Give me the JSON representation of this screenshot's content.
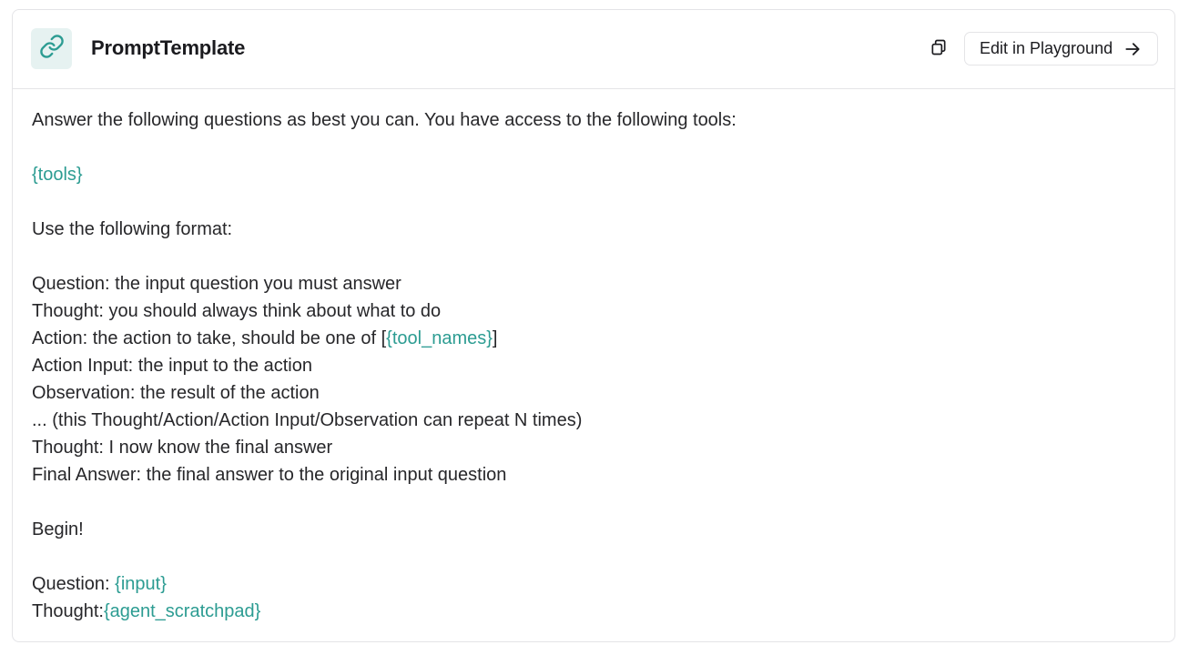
{
  "header": {
    "title": "PromptTemplate",
    "logo_icon": "link-icon",
    "copy_icon": "copy-icon",
    "edit_label": "Edit in Playground",
    "edit_icon": "arrow-right-icon"
  },
  "colors": {
    "accent": "#2c9c92",
    "logo_bg": "#e6f2f1",
    "text": "#27272a",
    "border": "#e4e4e7"
  },
  "template": {
    "line1": "Answer the following questions as best you can. You have access to the following tools:",
    "var_tools": "{tools}",
    "line_format": "Use the following format:",
    "q_line": "Question: the input question you must answer",
    "thought_line": "Thought: you should always think about what to do",
    "action_prefix": "Action: the action to take, should be one of [",
    "var_tool_names": "{tool_names}",
    "action_suffix": "]",
    "action_input_line": "Action Input: the input to the action",
    "observation_line": "Observation: the result of the action",
    "repeat_line": "... (this Thought/Action/Action Input/Observation can repeat N times)",
    "final_thought_line": "Thought: I now know the final answer",
    "final_answer_line": "Final Answer: the final answer to the original input question",
    "begin_line": "Begin!",
    "question_prefix": "Question: ",
    "var_input": "{input}",
    "thought_prefix": "Thought:",
    "var_agent_scratchpad": "{agent_scratchpad}"
  }
}
